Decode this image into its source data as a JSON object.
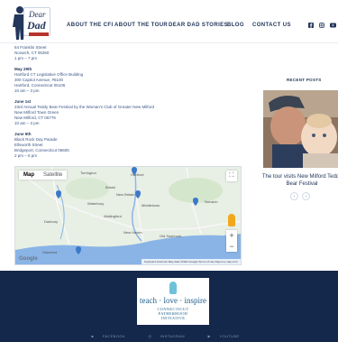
{
  "logo": {
    "line1": "Dear",
    "line2": "Dad"
  },
  "nav": [
    {
      "label": "ABOUT THE CFI"
    },
    {
      "label": "ABOUT THE TOUR"
    },
    {
      "label": "DEAR DAD STORIES"
    },
    {
      "label": "BLOG"
    },
    {
      "label": "CONTACT US"
    }
  ],
  "social_icons": [
    "facebook-icon",
    "instagram-icon",
    "youtube-icon"
  ],
  "events": [
    [
      "64 Franklin Street",
      "Norwich, CT 06360",
      "1 pm – 7 pm"
    ],
    [
      "May 29th",
      "Hartford CT Legislative Office Building",
      "300 Capitol Avenue, #5100",
      "Hartford, Connecticut 06106",
      "10 am – 3 pm"
    ],
    [
      "June 1st",
      "23rd Annual Teddy Bear Festival by the Woman's Club of Greater New Milford",
      "New Milford Town Green",
      "New Milford, CT 06776",
      "10 am – 3 pm"
    ],
    [
      "June 9th",
      "Black Rock Day Parade",
      "Ellsworth Street",
      "Bridgeport, Connecticut 06605",
      "2 pm – 6 pm"
    ]
  ],
  "sidebar": {
    "recent_label": "RECENT POSTS",
    "post_title": "The tour visits New Milford Teddy Bear Festival",
    "prev": "‹",
    "next": "›"
  },
  "map": {
    "tab_map": "Map",
    "tab_satellite": "Satellite",
    "zoom_in": "+",
    "zoom_out": "−",
    "fullscreen": "⛶",
    "brand": "Google",
    "footer_text": "Keyboard shortcuts  Map data ©2024 Google  Terms of Use  Report a map error",
    "labels": [
      "Torrington",
      "Hartford",
      "Bristol",
      "New Britain",
      "Waterbury",
      "Middletown",
      "Norwich",
      "Wallingford",
      "Danbury",
      "New Haven",
      "Old Saybrook",
      "Stamford"
    ]
  },
  "footer": {
    "motto": "teach · love · inspire",
    "org_line1": "CONNECTICUT",
    "org_line2": "FATHERHOOD",
    "org_line3": "INITIATIVE",
    "links": [
      "FACEBOOK",
      "INSTAGRAM",
      "YOUTUBE"
    ]
  }
}
